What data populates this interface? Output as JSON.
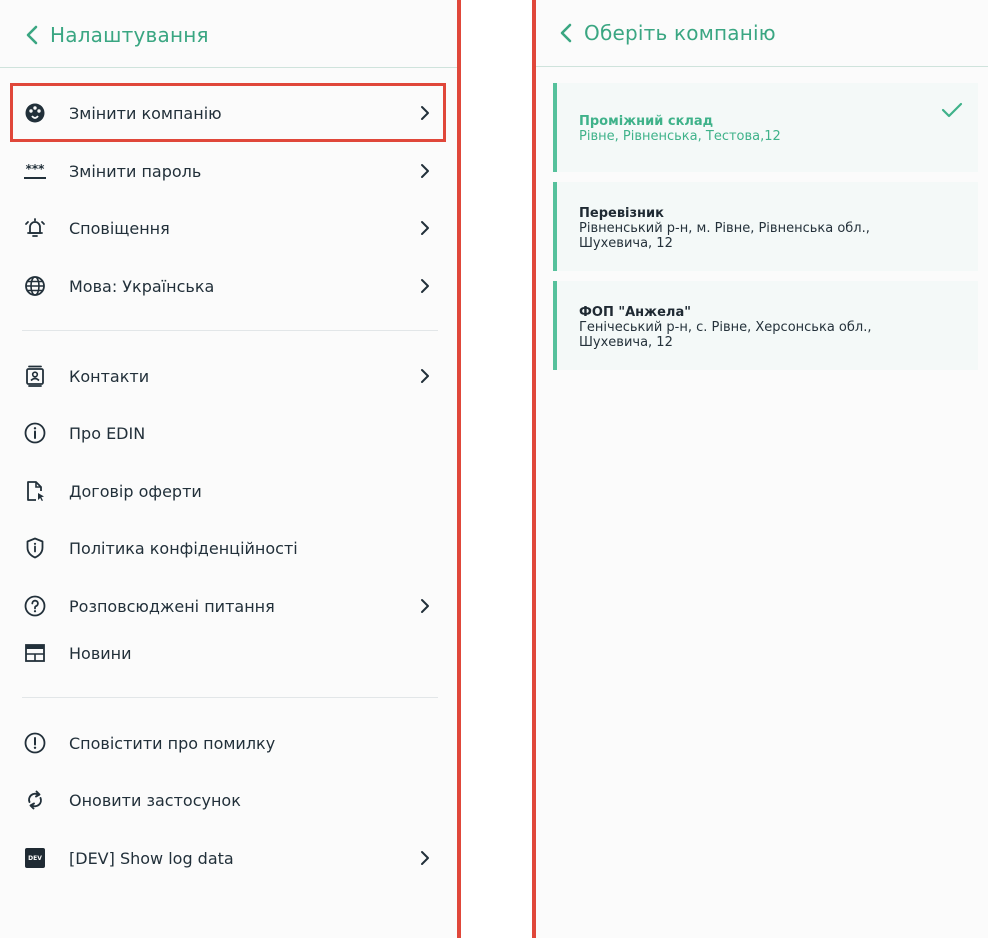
{
  "settings": {
    "title": "Налаштування",
    "items": [
      {
        "label": "Змінити компанію"
      },
      {
        "label": "Змінити пароль"
      },
      {
        "label": "Сповіщення"
      },
      {
        "label": "Мова: Українська"
      },
      {
        "label": "Контакти"
      },
      {
        "label": "Про EDIN"
      },
      {
        "label": "Договір оферти"
      },
      {
        "label": "Політика конфіденційності"
      },
      {
        "label": "Розповсюджені питання"
      },
      {
        "label": "Новини"
      },
      {
        "label": "Сповістити про помилку"
      },
      {
        "label": "Оновити застосунок"
      },
      {
        "label": "[DEV] Show log data"
      }
    ],
    "password_mask": "***",
    "dev_badge": "DEV"
  },
  "companies": {
    "title": "Оберіть компанію",
    "list": [
      {
        "name": "Проміжний склад",
        "address": "Рівне, Рівненська, Тестова,12"
      },
      {
        "name": "Перевізник",
        "address": "Рівненський р-н, м. Рівне, Рівненська обл., Шухевича, 12"
      },
      {
        "name": "ФОП \"Анжела\"",
        "address": "Генічеський р-н, с. Рівне, Херсонська обл., Шухевича, 12"
      }
    ]
  },
  "colors": {
    "accent": "#3aa682",
    "highlight": "#e0473a",
    "card_border": "#56c19c"
  },
  "icons": {
    "back": "chevron-left-icon",
    "chevron": "chevron-right-icon",
    "check": "check-icon"
  }
}
